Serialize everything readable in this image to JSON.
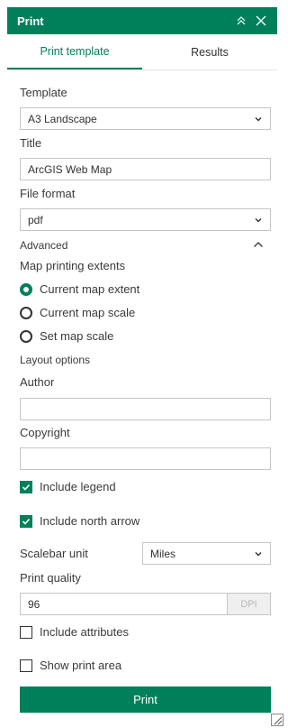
{
  "header": {
    "title": "Print"
  },
  "tabs": [
    {
      "label": "Print template",
      "active": true
    },
    {
      "label": "Results",
      "active": false
    }
  ],
  "template": {
    "label": "Template",
    "value": "A3 Landscape"
  },
  "title_field": {
    "label": "Title",
    "value": "ArcGIS Web Map"
  },
  "file_format": {
    "label": "File format",
    "value": "pdf"
  },
  "advanced": {
    "label": "Advanced"
  },
  "extents": {
    "label": "Map printing extents",
    "options": [
      {
        "label": "Current map extent",
        "selected": true
      },
      {
        "label": "Current map scale",
        "selected": false
      },
      {
        "label": "Set map scale",
        "selected": false
      }
    ]
  },
  "layout_options": {
    "label": "Layout options"
  },
  "author": {
    "label": "Author",
    "value": ""
  },
  "copyright": {
    "label": "Copyright",
    "value": ""
  },
  "include_legend": {
    "label": "Include legend",
    "checked": true
  },
  "include_north_arrow": {
    "label": "Include north arrow",
    "checked": true
  },
  "scalebar": {
    "label": "Scalebar unit",
    "value": "Miles"
  },
  "print_quality": {
    "label": "Print quality",
    "value": "96",
    "suffix": "DPI"
  },
  "include_attributes": {
    "label": "Include attributes",
    "checked": false
  },
  "show_print_area": {
    "label": "Show print area",
    "checked": false
  },
  "print_button": {
    "label": "Print"
  },
  "colors": {
    "accent": "#00805a",
    "text": "#323232",
    "border": "#c6c6c6"
  }
}
